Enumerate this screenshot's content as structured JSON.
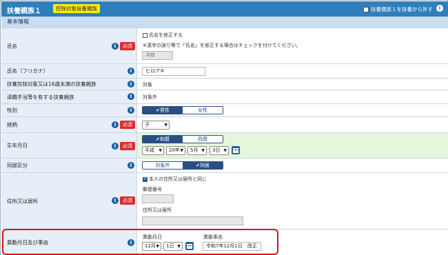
{
  "header": {
    "title": "扶養親族１",
    "badge": "控除対象扶養親族",
    "exclude_label": "扶養親族１を扶養から外す"
  },
  "section": {
    "title": "基本情報"
  },
  "required_label": "必須",
  "rows": {
    "name": {
      "label": "氏名",
      "modify_label": "氏名を修正する",
      "note": "※漢字の誤り等で「氏名」を修正する場合はチェックを付けてください。",
      "value": "洋郎"
    },
    "kana": {
      "label": "氏名（フリガナ）",
      "value": "ヒロアキ"
    },
    "under16": {
      "label": "扶養控除対象又は16歳未満の扶養親族",
      "value": "対象"
    },
    "retirement": {
      "label": "退職手当等を有する扶養親族",
      "value": "対象外"
    },
    "gender": {
      "label": "性別",
      "options": [
        "男性",
        "女性"
      ],
      "selected": "男性"
    },
    "relation": {
      "label": "続柄",
      "value": "子"
    },
    "birth": {
      "label": "生年月日",
      "era_options": [
        "和暦",
        "西暦"
      ],
      "era_selected": "和暦",
      "era": "平成",
      "year": "20年",
      "month": "5月",
      "day": "3日"
    },
    "cohabit": {
      "label": "同居区分",
      "options": [
        "対象外",
        "同居"
      ],
      "selected": "同居"
    },
    "address": {
      "label": "住所又は居所",
      "same_label": "本人の住所又は居所と同じ",
      "postal_label": "郵便番号",
      "address_label": "住所又は居所"
    },
    "change": {
      "label": "異動月日及び事由",
      "date_label": "異動月日",
      "month": "12月",
      "day": "1日",
      "reason_label": "異動事由",
      "reason_value": "令和7年12月1日　改正"
    }
  },
  "colors": {
    "header_bg": "#2f7fbd",
    "badge_bg": "#ffee00",
    "required_bg": "#e02a2a",
    "highlight": "#e01010",
    "segment_active": "#2a4f82"
  }
}
